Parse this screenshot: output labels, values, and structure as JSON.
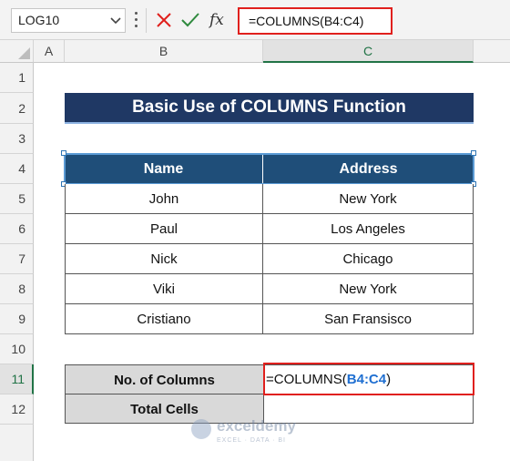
{
  "formula_bar": {
    "name_box": "LOG10",
    "fx_label": "fx",
    "formula": "=COLUMNS(B4:C4)"
  },
  "columns": [
    "A",
    "B",
    "C"
  ],
  "rows": [
    "1",
    "2",
    "3",
    "4",
    "5",
    "6",
    "7",
    "8",
    "9",
    "10",
    "11",
    "12"
  ],
  "title": "Basic Use of COLUMNS Function",
  "table": {
    "headers": [
      "Name",
      "Address"
    ],
    "rows": [
      [
        "John",
        "New York"
      ],
      [
        "Paul",
        "Los Angeles"
      ],
      [
        "Nick",
        "Chicago"
      ],
      [
        "Viki",
        "New York"
      ],
      [
        "Cristiano",
        "San Fransisco"
      ]
    ]
  },
  "summary": {
    "label_columns": "No. of Columns",
    "label_total": "Total Cells",
    "formula_prefix": "=COLUMNS(",
    "formula_ref": "B4:C4",
    "formula_suffix": ")"
  },
  "watermark": {
    "name": "exceldemy",
    "tagline": "EXCEL · DATA · BI"
  },
  "colors": {
    "title_bg": "#1f3864",
    "header_bg": "#1f4e79",
    "accent_red": "#e0201d",
    "excel_green": "#217346",
    "ref_blue": "#1f6fd1"
  }
}
